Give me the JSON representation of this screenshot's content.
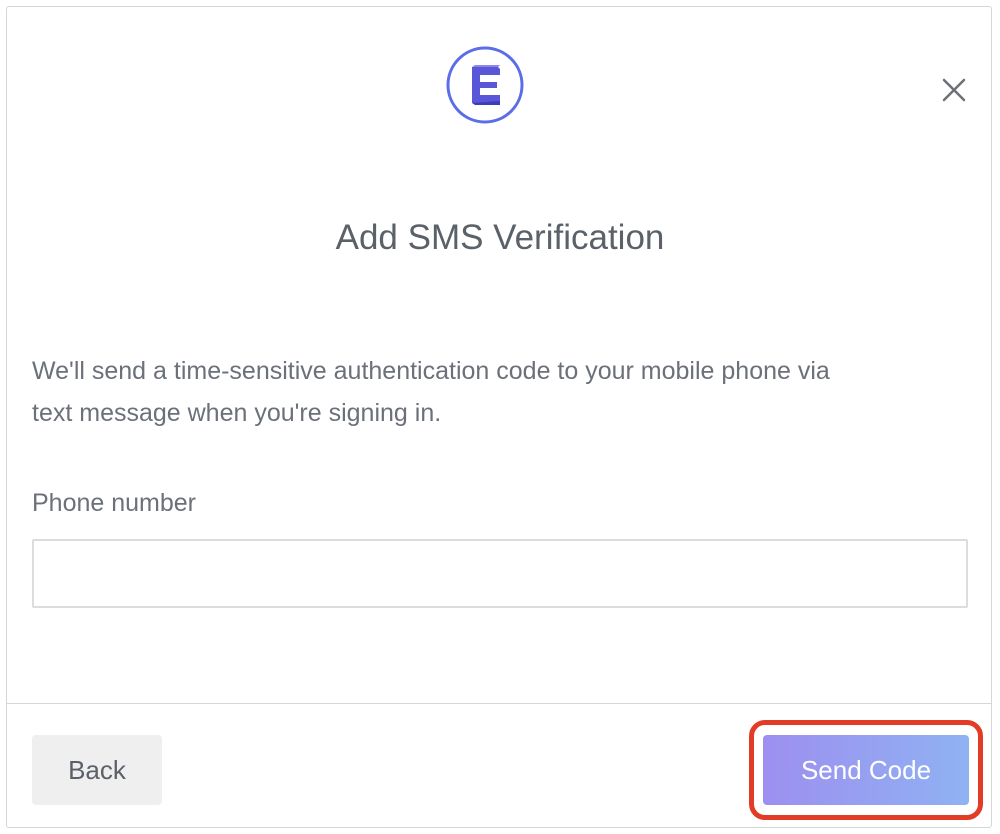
{
  "brand": {
    "logo_icon": "e-logo-icon",
    "colors": {
      "logo_ring": "#5b6ee8",
      "logo_letter": "#5a56d8",
      "primary_gradient_start": "#9d8ff0",
      "primary_gradient_end": "#8fb2f2",
      "highlight": "#e23b26"
    }
  },
  "header": {
    "close_icon": "close-icon"
  },
  "content": {
    "title": "Add SMS Verification",
    "description_line1": "We'll send a time-sensitive authentication code to your mobile phone via",
    "description_line2": "text message when you're signing in.",
    "phone_label": "Phone number",
    "phone_value": "",
    "phone_placeholder": ""
  },
  "footer": {
    "back_label": "Back",
    "send_label": "Send Code"
  }
}
